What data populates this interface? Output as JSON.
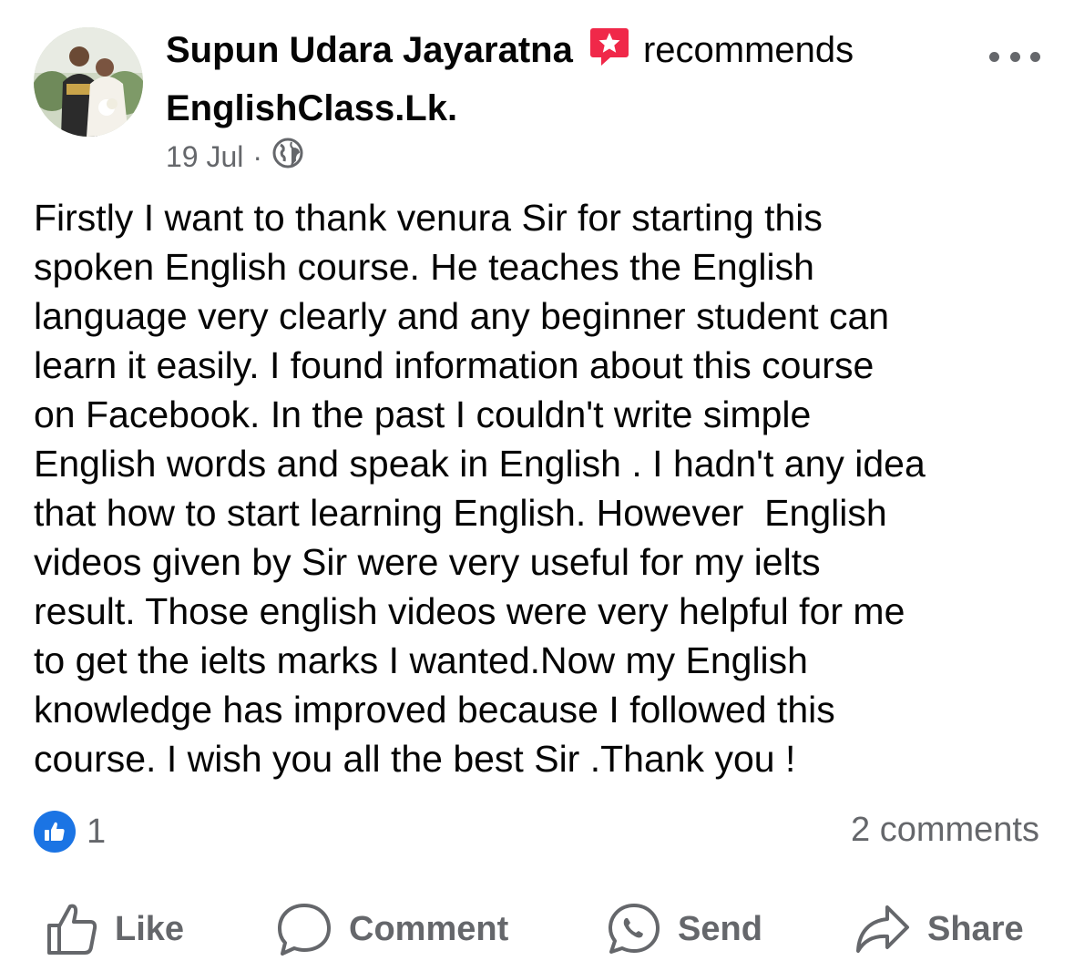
{
  "post": {
    "author": "Supun Udara Jayaratna",
    "verb": "recommends",
    "page": "EnglishClass.Lk.",
    "date": "19 Jul",
    "separator": "·",
    "privacy_icon": "globe-icon",
    "body": "Firstly I want to thank venura Sir for starting this\nspoken English course. He teaches the English\nlanguage very clearly and any beginner student can\nlearn it easily. I found information about this course\non Facebook. In the past I couldn't write simple\nEnglish words and speak in English . I hadn't any idea\nthat how to start learning English. However  English\nvideos given by Sir were very useful for my ielts\nresult. Those english videos were very helpful for me\nto get the ielts marks I wanted.Now my English\nknowledge has improved because I followed this\ncourse. I wish you all the best Sir .Thank you !"
  },
  "stats": {
    "like_count": "1",
    "comments": "2 comments"
  },
  "actions": {
    "like": "Like",
    "comment": "Comment",
    "send": "Send",
    "share": "Share"
  },
  "colors": {
    "recommend": "#f02849",
    "like_blue": "#1b74e4",
    "secondary_text": "#65676b"
  }
}
